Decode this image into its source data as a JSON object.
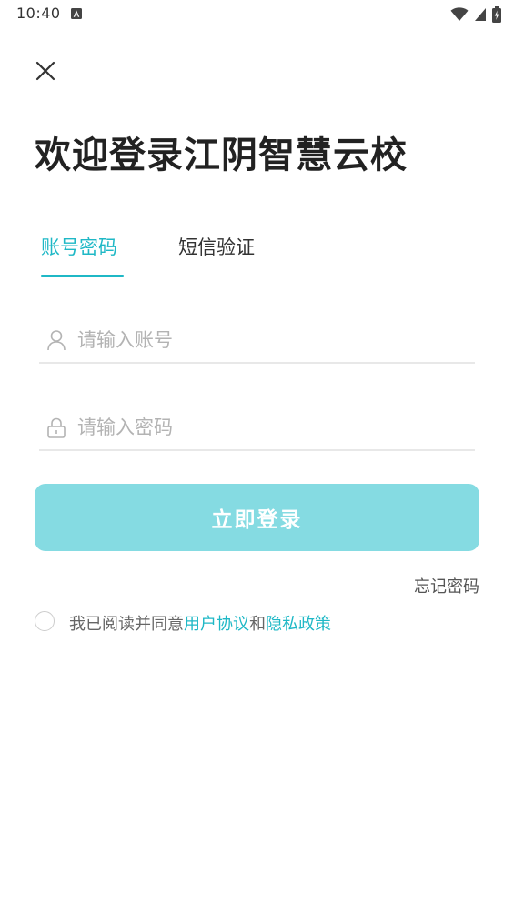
{
  "status_bar": {
    "time": "10:40",
    "notification_icon": "a-notification-icon",
    "wifi_icon": "wifi-icon",
    "signal_icon": "signal-icon",
    "battery_icon": "battery-charging-icon"
  },
  "header": {
    "close_icon": "close-icon",
    "title": "欢迎登录江阴智慧云校"
  },
  "tabs": [
    {
      "label": "账号密码",
      "active": true
    },
    {
      "label": "短信验证",
      "active": false
    }
  ],
  "form": {
    "account_placeholder": "请输入账号",
    "password_placeholder": "请输入密码",
    "account_icon": "user-icon",
    "password_icon": "lock-icon",
    "login_label": "立即登录",
    "forgot_label": "忘记密码"
  },
  "agreement": {
    "prefix": "我已阅读并同意",
    "user_agreement": "用户协议",
    "and": "和",
    "privacy_policy": "隐私政策"
  },
  "colors": {
    "accent": "#1fb8c6",
    "login_button_bg": "#85dbe2",
    "divider": "#e8e8e8",
    "placeholder": "#b3b3b3"
  }
}
